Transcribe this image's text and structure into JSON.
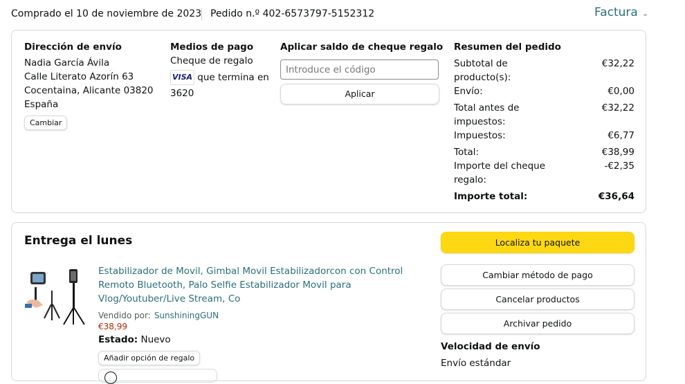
{
  "header": {
    "purchase_date": "Comprado el 10 de noviembre de 2023",
    "order_number": "Pedido n.º 402-6573797-5152312",
    "invoice_label": "Factura",
    "invoice_icon": "chevron-down-icon"
  },
  "shipping": {
    "heading": "Dirección de envío",
    "name": "Nadia García Ávila",
    "street": "Calle Literato Azorín 63",
    "city": "Cocentaina, Alicante 03820",
    "country": "España",
    "change_label": "Cambiar"
  },
  "payment": {
    "heading": "Medios de pago",
    "method": "Cheque de regalo",
    "card_brand": "VISA",
    "card_text_1": "que termina en",
    "card_text_2": "3620"
  },
  "gift_card": {
    "heading": "Aplicar saldo de cheque regalo",
    "placeholder": "Introduce el código",
    "apply_label": "Aplicar"
  },
  "summary": {
    "heading": "Resumen del pedido",
    "rows": [
      {
        "label_1": "Subtotal de",
        "label_2": "producto(s):",
        "value": "€32,22"
      },
      {
        "label_1": "Envío:",
        "label_2": "",
        "value": "€0,00"
      },
      {
        "label_1": "Total antes de",
        "label_2": "impuestos:",
        "value": "€32,22"
      },
      {
        "label_1": "Impuestos:",
        "label_2": "",
        "value": "€6,77"
      },
      {
        "label_1": "Total:",
        "label_2": "",
        "value": "€38,99"
      },
      {
        "label_1": "Importe del cheque",
        "label_2": "regalo:",
        "value": "-€2,35"
      }
    ],
    "grand_total_label": "Importe total:",
    "grand_total_value": "€36,64"
  },
  "delivery": {
    "heading": "Entrega el lunes",
    "product": {
      "title_1": "Estabilizador de Movil, Gimbal Movil Estabilizadorcon con Control",
      "title_2": "Remoto Bluetooth, Palo Selfie Estabilizador Movil para",
      "title_3": "Vlog/Youtuber/Live Stream, Co",
      "sold_by_label": "Vendido por:",
      "seller": "SunshiningGUN",
      "price": "€38,99",
      "condition_label": "Estado:",
      "condition_value": "Nuevo",
      "gift_option_label": "Añadir opción de regalo"
    },
    "actions": {
      "track": "Localiza tu paquete",
      "change_payment": "Cambiar método de pago",
      "cancel": "Cancelar productos",
      "archive": "Archivar pedido"
    },
    "shipping_speed_heading": "Velocidad de envío",
    "shipping_speed_value": "Envío estándar"
  },
  "colors": {
    "link": "#2a6f77",
    "price": "#b12704",
    "primary_button": "#ffd814",
    "border": "#d5d9d9"
  }
}
